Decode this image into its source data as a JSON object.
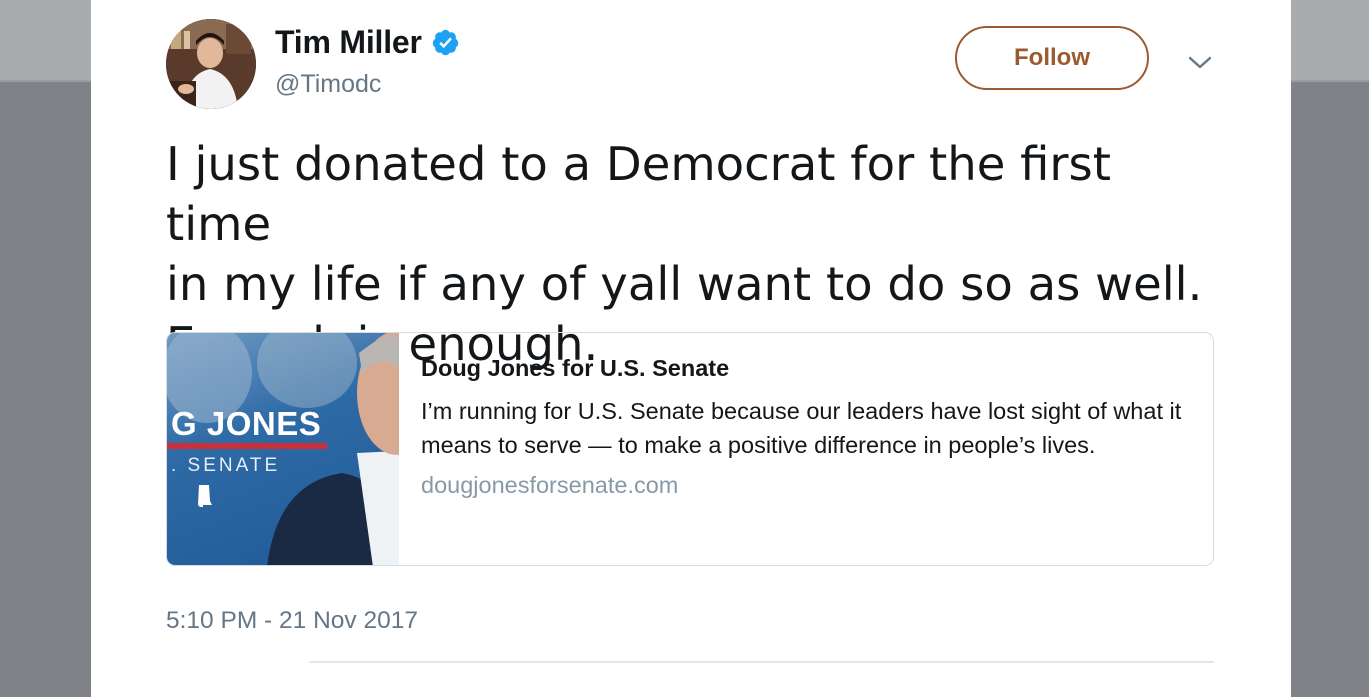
{
  "user": {
    "name": "Tim Miller",
    "handle": "@Timodc",
    "verified": true
  },
  "actions": {
    "follow_label": "Follow"
  },
  "tweet": {
    "text_lines": [
      "I just donated to a Democrat for the first time",
      "in my life if any of yall want to do so as well.",
      "Enough is enough."
    ],
    "timestamp": "5:10 PM - 21 Nov 2017"
  },
  "link_card": {
    "title": "Doug Jones for U.S. Senate",
    "description": "I’m running for U.S. Senate because our leaders have lost sight of what it means to serve — to make a positive difference in people’s lives.",
    "domain": "dougjonesforsenate.com",
    "image_text": {
      "banner": "G JONES",
      "sub": ". SENATE"
    }
  },
  "colors": {
    "follow_accent": "#9b5a30",
    "verified_blue": "#1da1f2",
    "secondary_text": "#657786",
    "link_gray": "#8899a6"
  },
  "icons": {
    "verified": "verified-badge-icon",
    "caret": "chevron-down-icon"
  }
}
